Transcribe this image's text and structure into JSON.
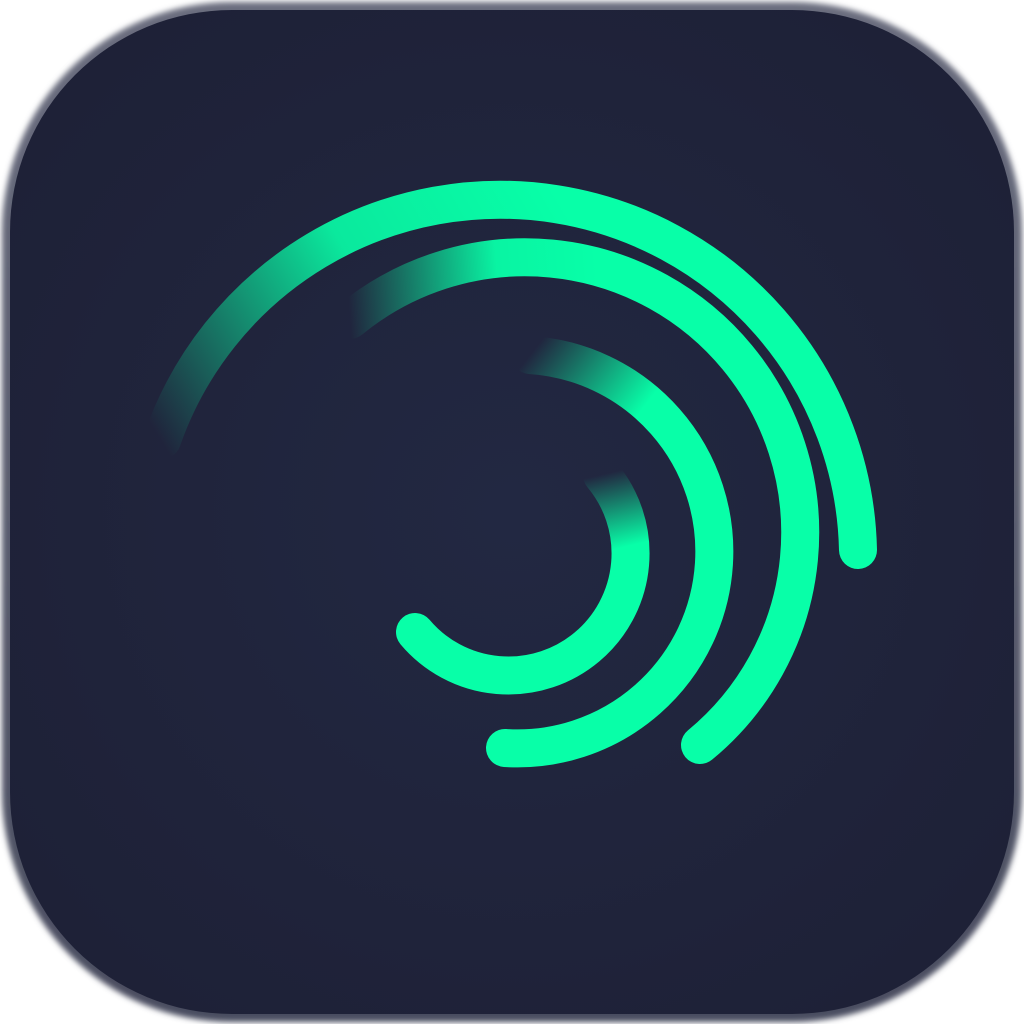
{
  "app_icon": {
    "icon_name": "swirl-arcs-logo-icon",
    "colors": {
      "tile_background": "#1F2338",
      "tile_edge": "#5E6172",
      "accent_green": "#08FFA8"
    }
  }
}
